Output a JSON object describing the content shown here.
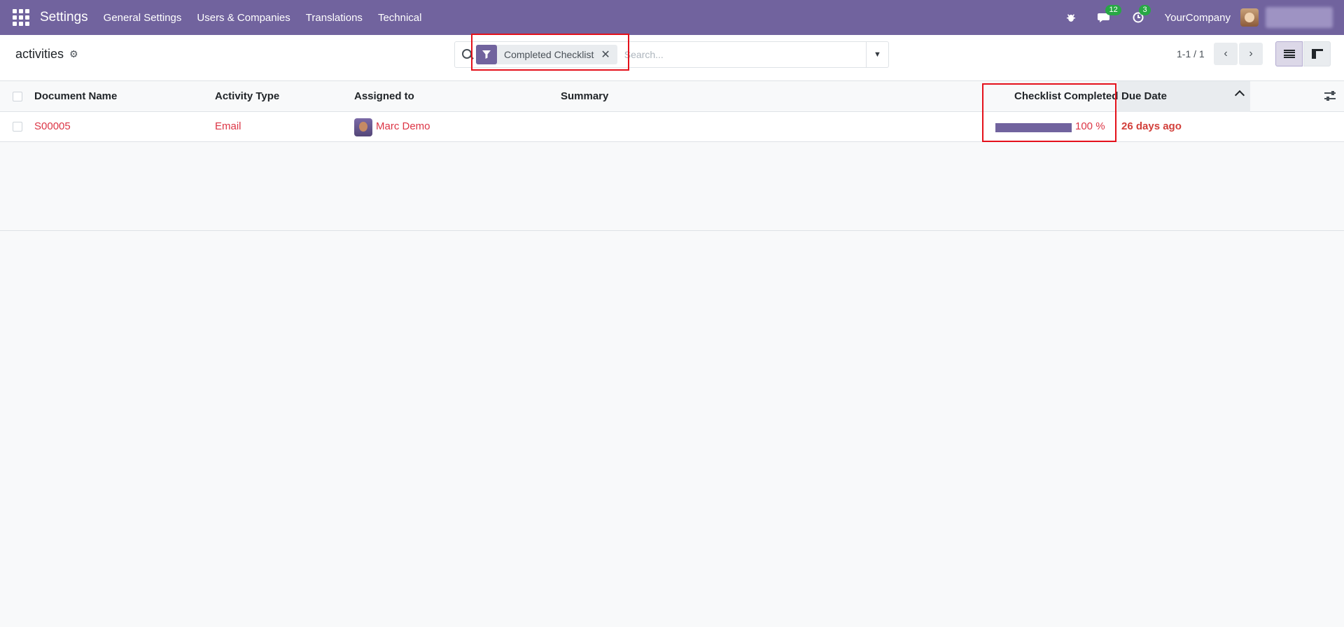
{
  "navbar": {
    "app_title": "Settings",
    "menu": [
      "General Settings",
      "Users & Companies",
      "Translations",
      "Technical"
    ],
    "messages_count": "12",
    "activities_count": "3",
    "company": "YourCompany"
  },
  "control_panel": {
    "breadcrumb": "activities",
    "search": {
      "facet_label": "Completed Checklist",
      "placeholder": "Search..."
    },
    "pager": "1-1 / 1"
  },
  "table": {
    "columns": [
      "Document Name",
      "Activity Type",
      "Assigned to",
      "Summary",
      "Checklist Completed",
      "Due Date"
    ],
    "rows": [
      {
        "document_name": "S00005",
        "activity_type": "Email",
        "assigned_to": "Marc Demo",
        "summary": "",
        "checklist_completed": 100,
        "checklist_label": "100 %",
        "due_date": "26 days ago"
      }
    ]
  },
  "colors": {
    "brand": "#71639e",
    "overdue": "#dc3545",
    "highlight": "#e4111b"
  }
}
